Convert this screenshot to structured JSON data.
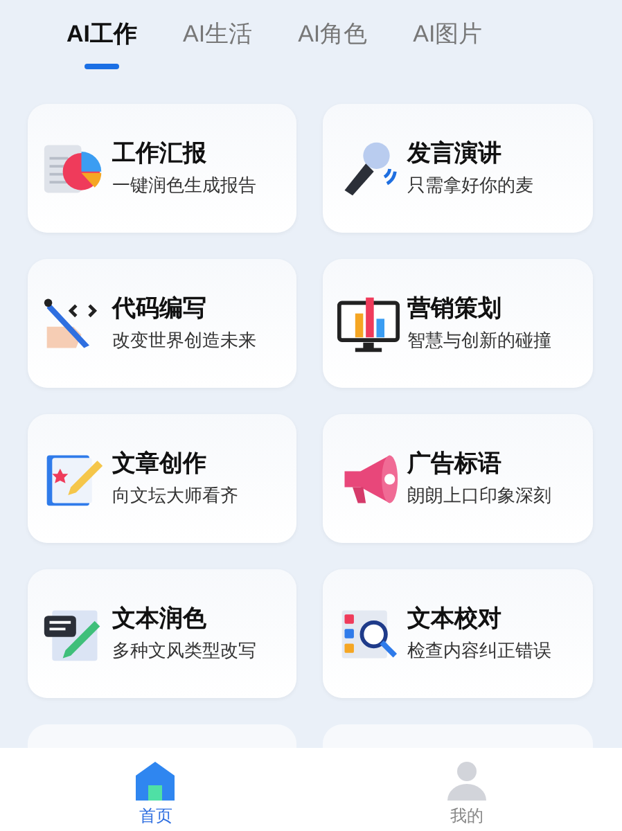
{
  "tabs": [
    {
      "label": "AI工作",
      "selected": true
    },
    {
      "label": "AI生活",
      "selected": false
    },
    {
      "label": "AI角色",
      "selected": false
    },
    {
      "label": "AI图片",
      "selected": false
    }
  ],
  "cards": [
    {
      "kind": "report",
      "title": "工作汇报",
      "subtitle": "一键润色生成报告"
    },
    {
      "kind": "mic",
      "title": "发言演讲",
      "subtitle": "只需拿好你的麦"
    },
    {
      "kind": "code",
      "title": "代码编写",
      "subtitle": "改变世界创造未来"
    },
    {
      "kind": "chart",
      "title": "营销策划",
      "subtitle": "智慧与创新的碰撞"
    },
    {
      "kind": "article",
      "title": "文章创作",
      "subtitle": "向文坛大师看齐"
    },
    {
      "kind": "megaphone",
      "title": "广告标语",
      "subtitle": "朗朗上口印象深刻"
    },
    {
      "kind": "polish",
      "title": "文本润色",
      "subtitle": "多种文风类型改写"
    },
    {
      "kind": "proofread",
      "title": "文本校对",
      "subtitle": "检查内容纠正错误"
    }
  ],
  "nav": [
    {
      "kind": "home",
      "label": "首页",
      "selected": true
    },
    {
      "kind": "user",
      "label": "我的",
      "selected": false
    }
  ]
}
